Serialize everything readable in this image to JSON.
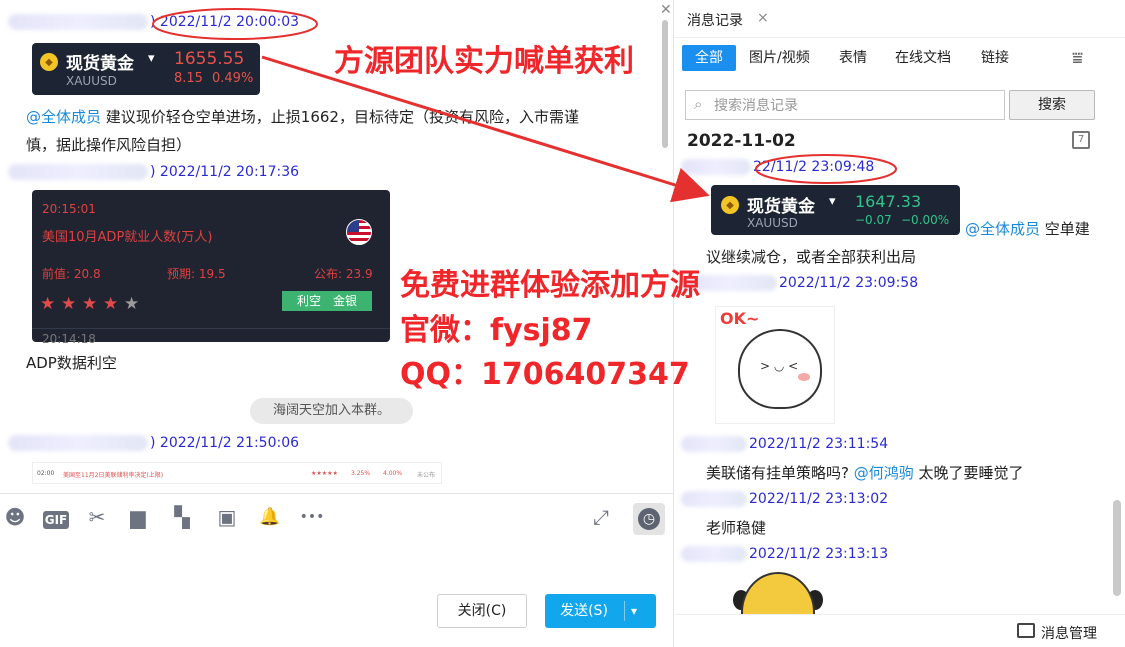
{
  "chat": {
    "messages": [
      {
        "timestamp": ") 2022/11/2 20:00:03"
      },
      {
        "timestamp": ") 2022/11/2 20:17:36"
      },
      {
        "timestamp": ") 2022/11/2 21:50:06"
      }
    ],
    "gold_card": {
      "name": "现货黄金",
      "dropdown": "▾",
      "code": "XAUUSD",
      "price": "1655.55",
      "change": "8.15",
      "change_pct": "0.49%"
    },
    "call_message": {
      "mention": "@全体成员",
      "text_line1": " 建议现价轻仓空单进场，止损1662，目标待定（投资有风险，入市需谨",
      "text_line2": "慎，据此操作风险自担）"
    },
    "news_card": {
      "time": "20:15:01",
      "title": "美国10月ADP就业人数(万人)",
      "prev": "前值: 20.8",
      "forecast": "预期: 19.5",
      "actual": "公布: 23.9",
      "stars": 4,
      "star_total": 5,
      "tag": "利空　金银",
      "next_time": "20:14:18"
    },
    "adp_comment": "ADP数据利空",
    "system_notice": "海阔天空加入本群。",
    "mini_strip": {
      "time": "02:00",
      "title": "美国至11月2日美联储利率决定(上限)",
      "value1": "3.25%",
      "value2": "4.00%",
      "status": "未公布"
    },
    "toolbar": {
      "emoji_icon": "☻",
      "gif_label": "GIF",
      "scissors_icon": "✂",
      "folder_icon": "▆",
      "doc_icon": "▚",
      "image_icon": "▣",
      "bell_icon": "🔔",
      "more_icon": "•••",
      "expand_icon": "⤢",
      "clock_icon": "◷"
    },
    "buttons": {
      "close": "关闭(C)",
      "send": "发送(S)",
      "send_dropdown": "▾"
    }
  },
  "promo": {
    "headline": "方源团队实力喊单获利",
    "line1": "免费进群体验添加方源",
    "line2": "官微：fysj87",
    "line3": "QQ：1706407347"
  },
  "history": {
    "tab_title": "消息记录",
    "tab_close": "×",
    "filters": [
      "全部",
      "图片/视频",
      "表情",
      "在线文档",
      "链接"
    ],
    "filter_icon": "⩸",
    "search": {
      "placeholder": "搜索消息记录",
      "button": "搜索",
      "icon": "⌕"
    },
    "date": "2022-11-02",
    "calendar_icon": "7",
    "gold_card": {
      "name": "现货黄金",
      "dropdown": "▾",
      "code": "XAUUSD",
      "price": "1647.33",
      "change": "−0.07",
      "change_pct": "−0.00%"
    },
    "entries": [
      {
        "timestamp": "22/11/2 23:09:48"
      },
      {
        "timestamp": "2022/11/2 23:09:58"
      },
      {
        "timestamp": "2022/11/2 23:11:54"
      },
      {
        "timestamp": "2022/11/2 23:13:02"
      },
      {
        "timestamp": "2022/11/2 23:13:13"
      }
    ],
    "msg1": {
      "mention": "@全体成员",
      "text_a": " 空单建",
      "text_b": "议继续减仓，或者全部获利出局"
    },
    "msg2": {
      "text": "美联储有挂单策略吗?",
      "mention": "@何鸿驹",
      "text_b": " 太晚了要睡觉了"
    },
    "msg3": {
      "text": "老师稳健"
    },
    "sticker_text": "OK~",
    "footer": {
      "label": "消息管理"
    }
  },
  "colors": {
    "accent": "#1a8ff0",
    "send": "#12a7ec",
    "promo_red": "#f0272a",
    "timestamp": "#2a2ad0",
    "mention": "#1a8ad8",
    "card_bg": "#1d2433",
    "up_red": "#e8524a",
    "down_green": "#32c28b"
  }
}
